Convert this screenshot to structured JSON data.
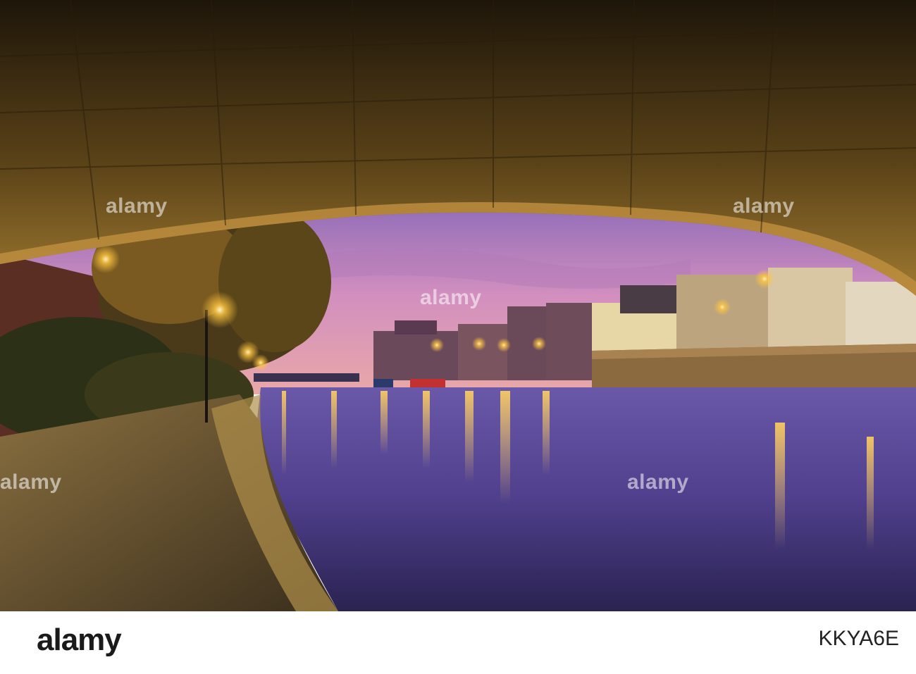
{
  "photo": {
    "description_icon": "photo",
    "colors": {
      "sky_top": "#3b3f8f",
      "sky_mid": "#8a64b8",
      "sky_glow": "#d98fc0",
      "water": "#5a4a9a",
      "arch_stone": "#3a2a12",
      "arch_light": "#8a6a2a",
      "lamp": "#ffc640"
    }
  },
  "watermarks": [
    "alamy",
    "alamy",
    "alamy",
    "alamy",
    "alamy"
  ],
  "footer": {
    "brand": "alamy",
    "image_id": "KKYA6E"
  }
}
